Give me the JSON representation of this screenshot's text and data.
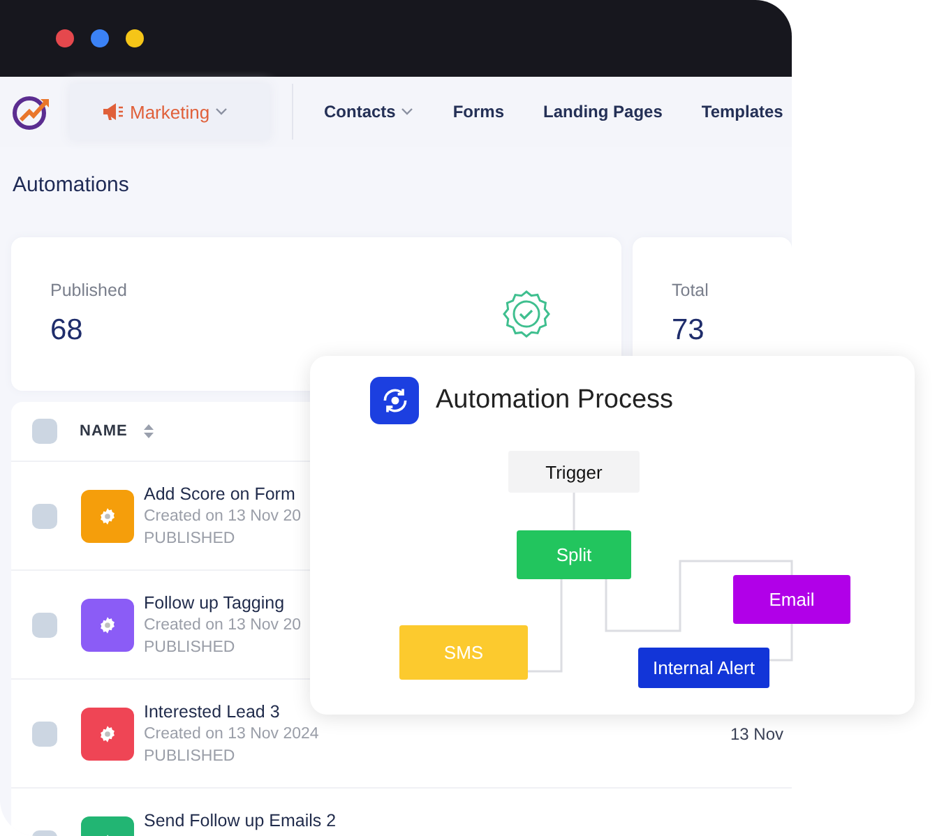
{
  "nav": {
    "items": [
      {
        "label": "Marketing",
        "selected": true,
        "dropdown": true
      },
      {
        "label": "Contacts",
        "selected": false,
        "dropdown": true
      },
      {
        "label": "Forms",
        "selected": false,
        "dropdown": false
      },
      {
        "label": "Landing Pages",
        "selected": false,
        "dropdown": false
      },
      {
        "label": "Templates",
        "selected": false,
        "dropdown": false
      }
    ]
  },
  "page_title": "Automations",
  "stats": [
    {
      "label": "Published",
      "value": "68",
      "kind": "published"
    },
    {
      "label": "Total",
      "value": "73",
      "kind": "total"
    }
  ],
  "table": {
    "header_checkbox": {
      "checked": false
    },
    "columns": [
      "NAME"
    ],
    "rows": [
      {
        "name": "Add Score on Form",
        "created": "Created on 13 Nov 20",
        "status": "PUBLISHED",
        "color": "#f59e0b",
        "checked": false
      },
      {
        "name": "Follow up Tagging",
        "created": "Created on 13 Nov 20",
        "status": "PUBLISHED",
        "color": "#8b5cf6",
        "checked": false
      },
      {
        "name": "Interested Lead 3",
        "created": "Created on 13 Nov 2024",
        "status": "PUBLISHED",
        "date": "13 Nov",
        "color": "#ef4555",
        "checked": false
      },
      {
        "name": "Send Follow up Emails 2",
        "color": "#22b573",
        "checked": false
      }
    ]
  },
  "automation_card": {
    "title": "Automation Process",
    "nodes": [
      {
        "label": "Trigger",
        "color": "#f3f3f4"
      },
      {
        "label": "Split",
        "color": "#22c55e"
      },
      {
        "label": "SMS",
        "color": "#fcca2e"
      },
      {
        "label": "Email",
        "color": "#b100e8"
      },
      {
        "label": "Internal Alert",
        "color": "#1235d8"
      }
    ]
  }
}
